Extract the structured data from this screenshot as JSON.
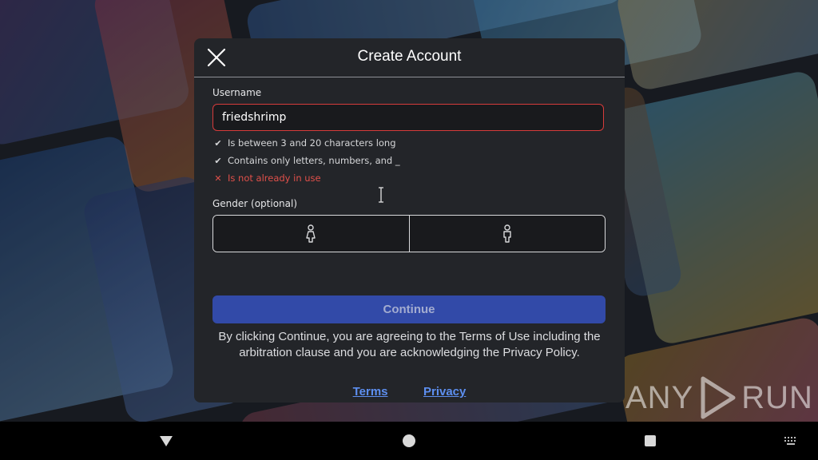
{
  "dialog": {
    "title": "Create Account",
    "username": {
      "label": "Username",
      "value": "friedshrimp",
      "rules": [
        {
          "text": "Is between 3 and 20 characters long",
          "status": "ok"
        },
        {
          "text": "Contains only letters, numbers, and _",
          "status": "ok"
        },
        {
          "text": "Is not already in use",
          "status": "error"
        }
      ]
    },
    "gender": {
      "label": "Gender (optional)",
      "options": [
        "female-icon",
        "male-icon"
      ]
    },
    "continue_label": "Continue",
    "legal_text": "By clicking Continue, you are agreeing to the Terms of Use including the arbitration clause and you are acknowledging the Privacy Policy.",
    "links": {
      "terms": "Terms",
      "privacy": "Privacy"
    }
  },
  "watermark": {
    "left": "ANY",
    "right": "RUN"
  },
  "colors": {
    "error": "#e0504a",
    "accent": "#324aa8",
    "link": "#5d8ff0"
  }
}
